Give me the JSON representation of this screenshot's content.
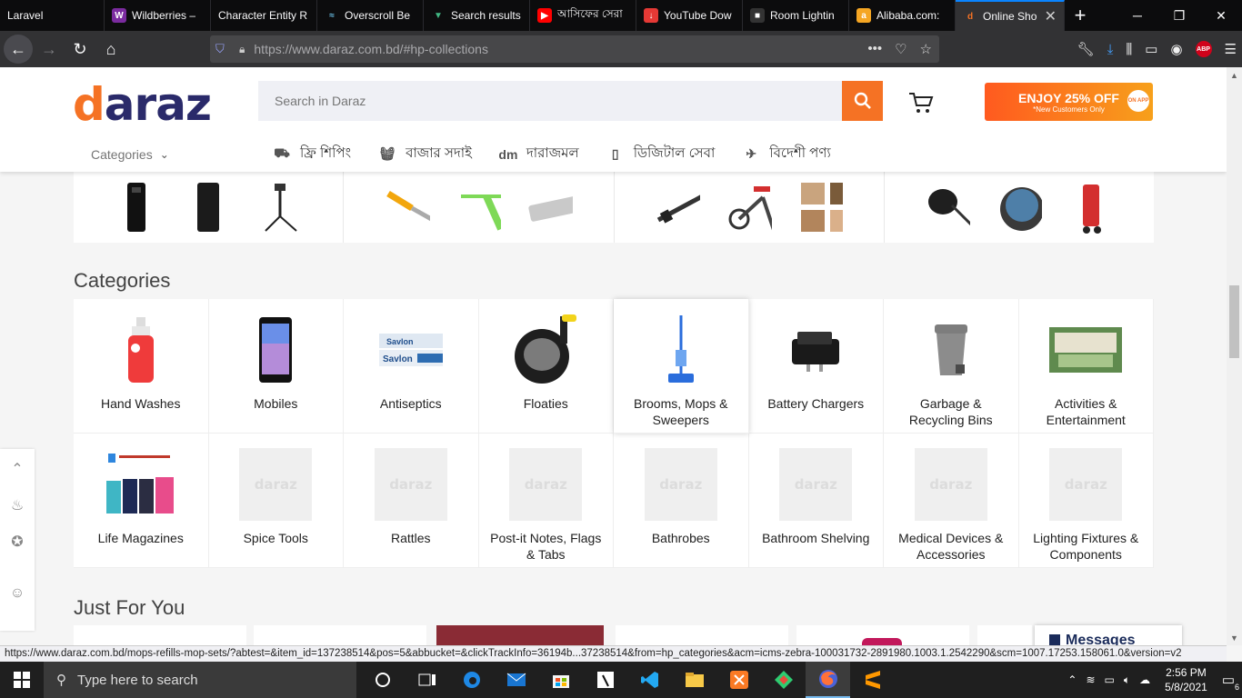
{
  "browser": {
    "tabs": [
      {
        "label": "Laravel",
        "icon": "none"
      },
      {
        "label": "Wildberries –",
        "icon": "wildberries-icon",
        "color": "#7b2b9f"
      },
      {
        "label": "Character Entity R",
        "icon": "none"
      },
      {
        "label": "Overscroll Be",
        "icon": "overscroll-icon",
        "color": "#3a8fb7"
      },
      {
        "label": "Search results",
        "icon": "vue-icon",
        "color": "#41b883"
      },
      {
        "label": "আসিফের সেরা",
        "icon": "youtube-icon",
        "color": "#ff0000"
      },
      {
        "label": "YouTube Dow",
        "icon": "download-icon",
        "color": "#e53935"
      },
      {
        "label": "Room Lightin",
        "icon": "room-icon",
        "color": "#222222"
      },
      {
        "label": "Alibaba.com:",
        "icon": "alibaba-icon",
        "color": "#f5a623"
      }
    ],
    "active_tab": {
      "label": "Online Sho",
      "icon": "daraz-icon"
    },
    "url": "https://www.daraz.com.bd/#hp-collections"
  },
  "header": {
    "logo": "daraz",
    "search_placeholder": "Search in Daraz",
    "promo_big": "ENJOY 25% OFF",
    "promo_small": "*New Customers Only",
    "promo_badge": "ON APP",
    "categories_label": "Categories",
    "nav_links": [
      {
        "label": "ফ্রি শিপিং",
        "icon": "free-shipping-icon"
      },
      {
        "label": "বাজার সদাই",
        "icon": "basket-icon"
      },
      {
        "label": "দারাজমল",
        "icon": "daraz-mall-icon"
      },
      {
        "label": "ডিজিটাল সেবা",
        "icon": "phone-icon"
      },
      {
        "label": "বিদেশী পণ্য",
        "icon": "plane-icon"
      }
    ]
  },
  "sections": {
    "categories_title": "Categories",
    "just_for_you_title": "Just For You"
  },
  "categories": [
    {
      "name": "Hand Washes",
      "image": "hand-wash-bottle"
    },
    {
      "name": "Mobiles",
      "image": "mobile-phone"
    },
    {
      "name": "Antiseptics",
      "image": "savlon-antiseptic"
    },
    {
      "name": "Floaties",
      "image": "snorkel-mask"
    },
    {
      "name": "Brooms, Mops & Sweepers",
      "image": "mop"
    },
    {
      "name": "Battery Chargers",
      "image": "charger"
    },
    {
      "name": "Garbage & Recycling Bins",
      "image": "bin"
    },
    {
      "name": "Activities & Entertainment",
      "image": "event-decor"
    },
    {
      "name": "Life Magazines",
      "image": "magazines"
    },
    {
      "name": "Spice Tools",
      "image": "placeholder"
    },
    {
      "name": "Rattles",
      "image": "placeholder"
    },
    {
      "name": "Post-it Notes, Flags & Tabs",
      "image": "placeholder"
    },
    {
      "name": "Bathrobes",
      "image": "placeholder"
    },
    {
      "name": "Bathroom Shelving",
      "image": "placeholder"
    },
    {
      "name": "Medical Devices & Accessories",
      "image": "placeholder"
    },
    {
      "name": "Lighting Fixtures & Components",
      "image": "placeholder"
    }
  ],
  "placeholder_text": "daraz",
  "messages_label": "Messages",
  "status_url": "https://www.daraz.com.bd/mops-refills-mop-sets/?abtest=&item_id=137238514&pos=5&abbucket=&clickTrackInfo=36194b...37238514&from=hp_categories&acm=icms-zebra-100031732-2891980.1003.1.2542290&scm=1007.17253.158061.0&version=v2",
  "taskbar": {
    "search_placeholder": "Type here to search",
    "time": "2:56 PM",
    "date": "5/8/2021",
    "notifications": "6"
  },
  "colors": {
    "accent": "#f57224",
    "logo_dark": "#2a2a6a"
  }
}
